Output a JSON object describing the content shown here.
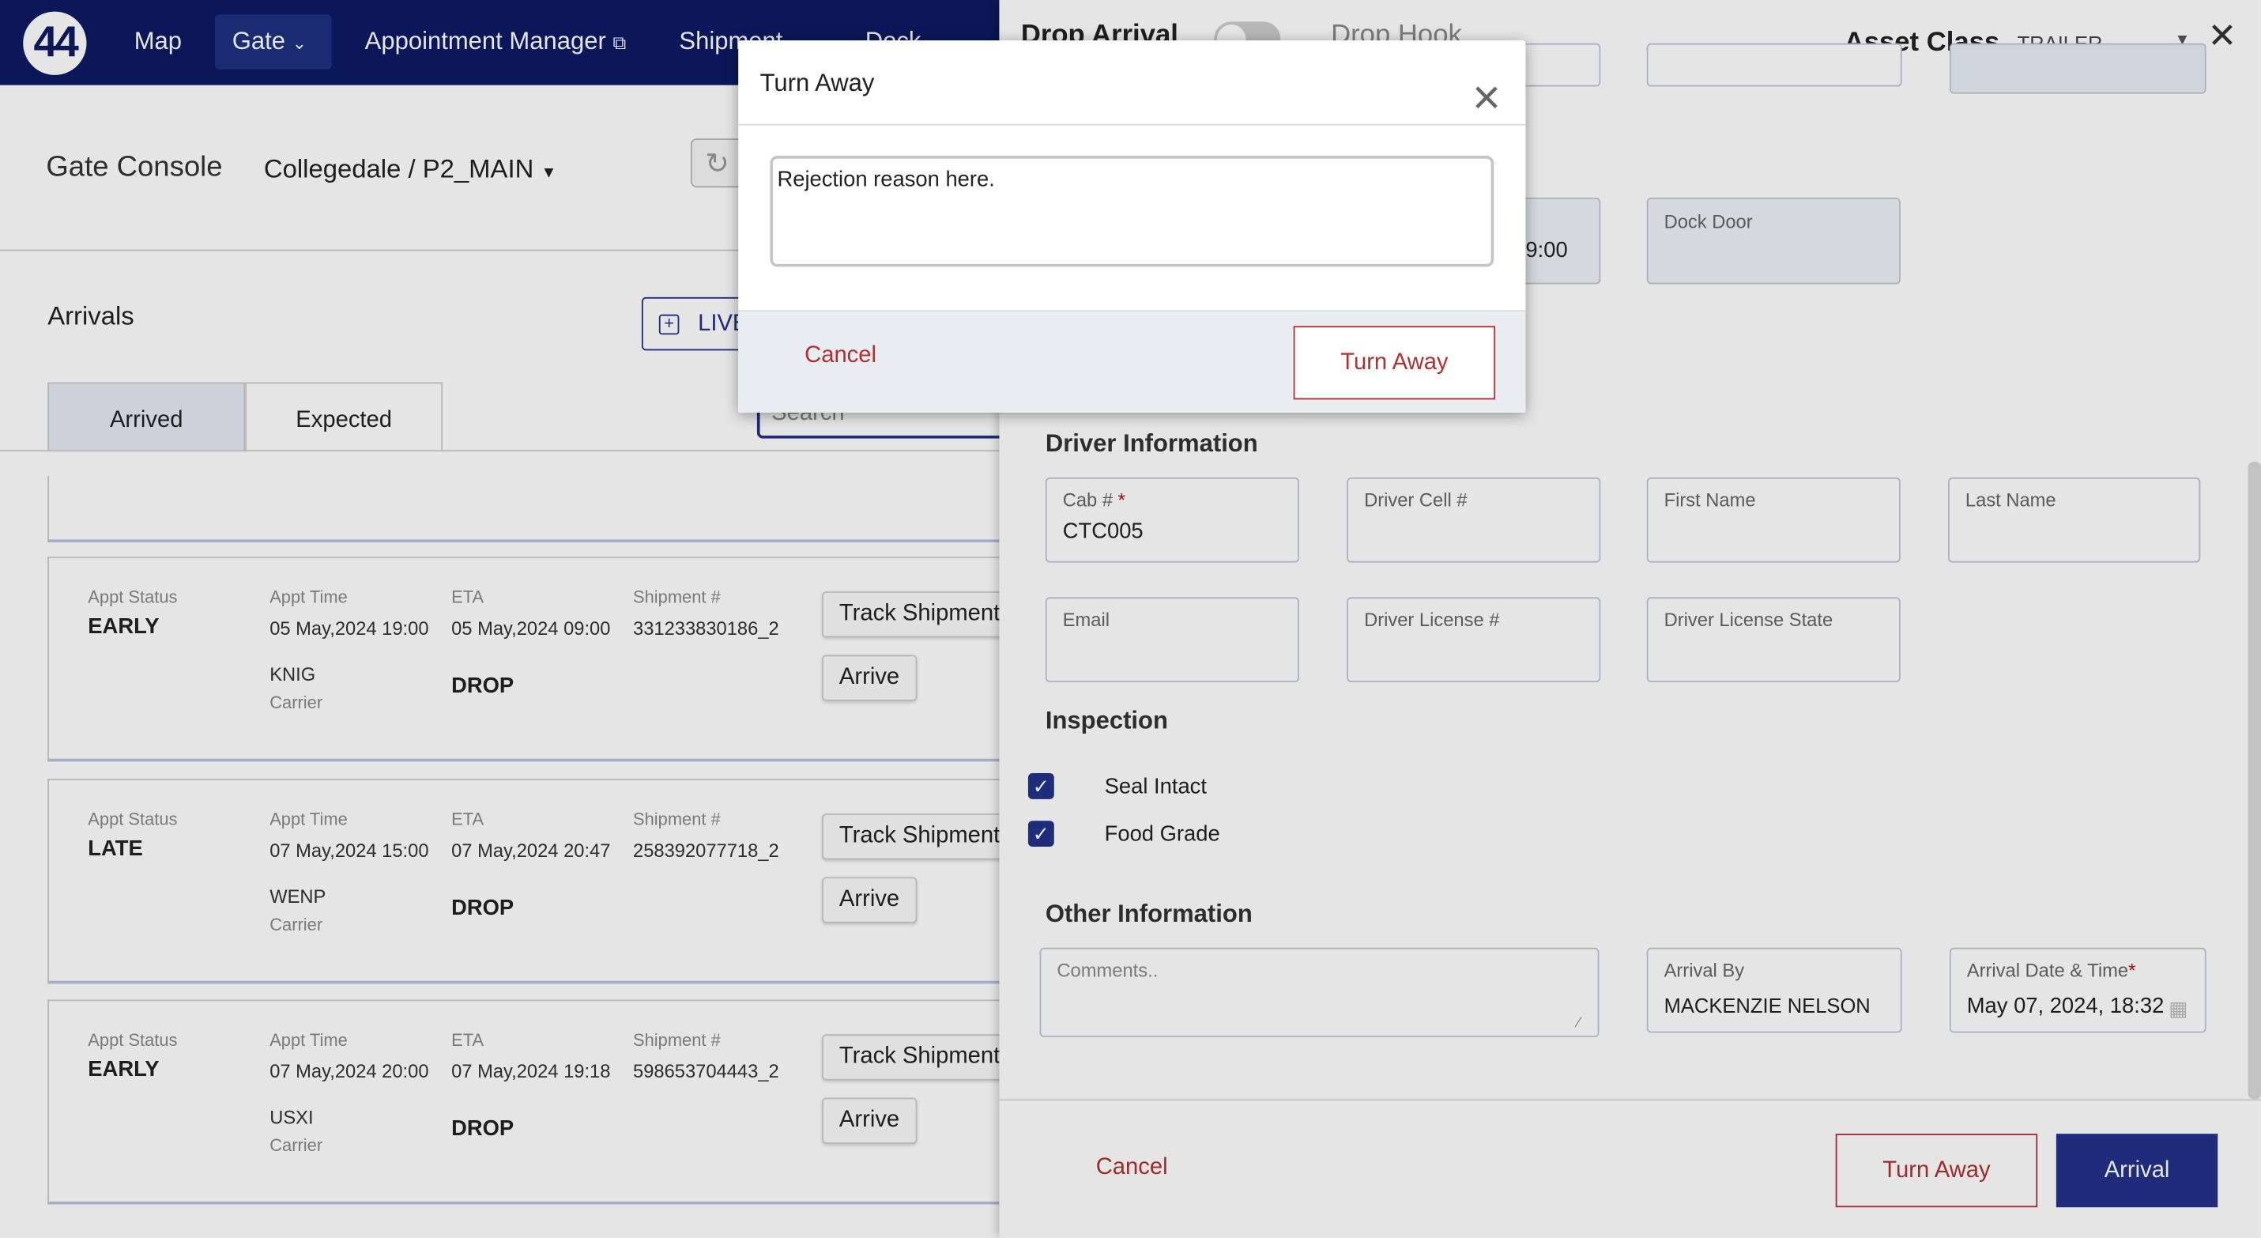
{
  "nav": {
    "logo": "44",
    "items": [
      "Map",
      "Gate",
      "Appointment Manager",
      "Shipment",
      "Dock"
    ]
  },
  "console": {
    "title": "Gate Console",
    "location": "Collegedale / P2_MAIN",
    "arrivals_title": "Arrivals",
    "live_button": "LIVE",
    "tabs": [
      "Arrived",
      "Expected"
    ],
    "search_placeholder": "Search"
  },
  "cards": [
    {
      "status_label": "Appt Status",
      "status": "EARLY",
      "appt_label": "Appt Time",
      "appt": "05 May,2024 19:00",
      "eta_label": "ETA",
      "eta": "05 May,2024 09:00",
      "ship_label": "Shipment #",
      "ship": "331233830186_2",
      "carrier": "KNIG",
      "carrier_label": "Carrier",
      "type": "DROP",
      "track": "Track Shipment",
      "arrive": "Arrive"
    },
    {
      "status_label": "Appt Status",
      "status": "LATE",
      "appt_label": "Appt Time",
      "appt": "07 May,2024 15:00",
      "eta_label": "ETA",
      "eta": "07 May,2024 20:47",
      "ship_label": "Shipment #",
      "ship": "258392077718_2",
      "carrier": "WENP",
      "carrier_label": "Carrier",
      "type": "DROP",
      "track": "Track Shipment",
      "arrive": "Arrive"
    },
    {
      "status_label": "Appt Status",
      "status": "EARLY",
      "appt_label": "Appt Time",
      "appt": "07 May,2024 20:00",
      "eta_label": "ETA",
      "eta": "07 May,2024 19:18",
      "ship_label": "Shipment #",
      "ship": "598653704443_2",
      "carrier": "USXI",
      "carrier_label": "Carrier",
      "type": "DROP",
      "track": "Track Shipment",
      "arrive": "Arrive"
    }
  ],
  "panel": {
    "drop_arrival": "Drop Arrival",
    "drop_hook": "Drop Hook",
    "asset_class_label": "Asset Class",
    "asset_class_value": "TRAILER",
    "partial_time": "9:00",
    "dock_door_label": "Dock Door",
    "driver_section": "Driver Information",
    "cab_label": "Cab #",
    "cab_value": "CTC005",
    "driver_cell_label": "Driver Cell #",
    "first_name_label": "First Name",
    "last_name_label": "Last Name",
    "email_label": "Email",
    "license_label": "Driver License #",
    "license_state_label": "Driver License State",
    "inspection_section": "Inspection",
    "seal_intact": "Seal Intact",
    "food_grade": "Food Grade",
    "other_section": "Other Information",
    "comments_placeholder": "Comments..",
    "arrival_by_label": "Arrival By",
    "arrival_by_value": "MACKENZIE NELSON",
    "arrival_dt_label": "Arrival Date & Time",
    "arrival_dt_value": "May 07, 2024, 18:32",
    "cancel": "Cancel",
    "turn_away": "Turn Away",
    "arrival": "Arrival"
  },
  "modal": {
    "title": "Turn Away",
    "reason": "Rejection reason here.",
    "cancel": "Cancel",
    "turn_away": "Turn Away"
  },
  "colors": {
    "nav": "#0d1a63",
    "primary": "#23308a",
    "danger": "#b03030"
  }
}
